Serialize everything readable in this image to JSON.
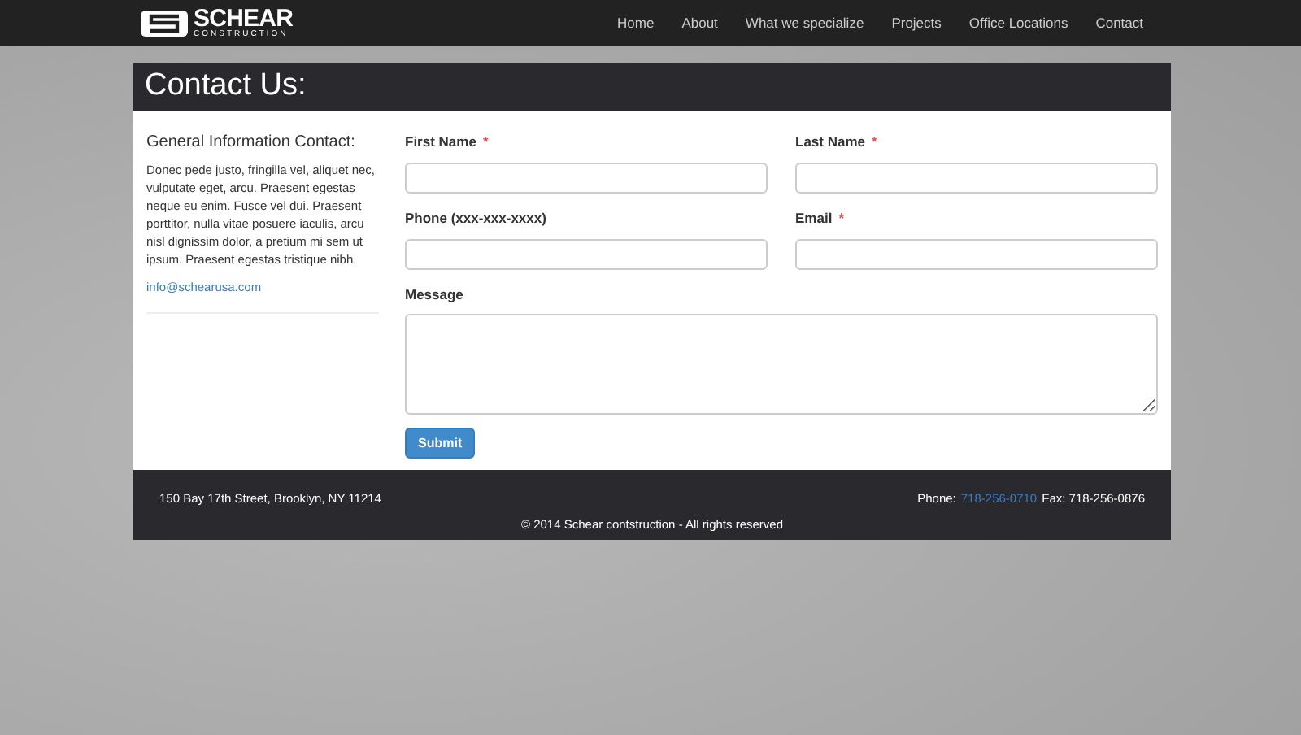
{
  "brand": {
    "name": "SCHEAR",
    "tagline": "CONSTRUCTION"
  },
  "nav": [
    {
      "label": "Home"
    },
    {
      "label": "About"
    },
    {
      "label": "What we specialize"
    },
    {
      "label": "Projects"
    },
    {
      "label": "Office Locations"
    },
    {
      "label": "Contact"
    }
  ],
  "page_title": "Contact Us:",
  "info": {
    "heading": "General Information Contact:",
    "body": "Donec pede justo, fringilla vel, aliquet nec, vulputate eget, arcu. Praesent egestas neque eu enim. Fusce vel dui. Praesent porttitor, nulla vitae posuere iaculis, arcu nisl dignissim dolor, a pretium mi sem ut ipsum. Praesent egestas tristique nibh.",
    "email": "info@schearusa.com"
  },
  "form": {
    "fields": [
      {
        "label": "First Name",
        "required": true,
        "kind": "input"
      },
      {
        "label": "Last Name",
        "required": true,
        "kind": "input"
      },
      {
        "label": "Phone (xxx-xxx-xxxx)",
        "required": false,
        "kind": "input"
      },
      {
        "label": "Email",
        "required": true,
        "kind": "input"
      },
      {
        "label": "Message",
        "required": false,
        "kind": "textarea"
      }
    ],
    "required_mark": "*",
    "submit": "Submit"
  },
  "footer": {
    "address": "150 Bay 17th Street, Brooklyn, NY 11214",
    "phone_label": "Phone:",
    "phone": "718-256-0710",
    "fax": "Fax: 718-256-0876",
    "copyright": "© 2014 Schear contstruction - All rights reserved"
  }
}
